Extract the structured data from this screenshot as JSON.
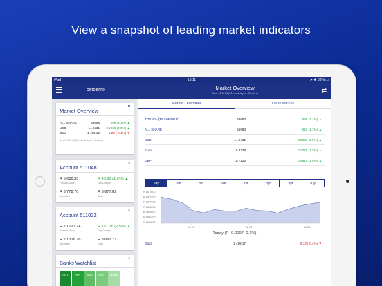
{
  "headline": "View a snapshot of leading market indicators",
  "status_bar": {
    "device": "iPad",
    "time": "16:11",
    "battery": "83%"
  },
  "app_header": {
    "user": "ostdemo",
    "title": "Market Overview",
    "subtitle": "As at 16:11:53 (15 min delayed - Reuters)"
  },
  "sidebar": {
    "market_overview": {
      "title": "Market Overview",
      "rows": [
        {
          "name": "ALL SHARE",
          "value": "55668",
          "change": "596 (1.1%)",
          "dir": "up"
        },
        {
          "name": "USD",
          "value": "14.9431",
          "change": "0.2926 (2.0%)",
          "dir": "up"
        },
        {
          "name": "Gold",
          "value": "1 499.10",
          "change": "-6.20 (-0.4%)",
          "dir": "down"
        }
      ],
      "note": "As at 16:04:42 (15 min delayed - Reuters)"
    },
    "accounts": [
      {
        "title": "Account 511048",
        "portfolio_value": "R 5 056.33",
        "portfolio_label": "Portfolio Value",
        "day_change": "R 48.80 (1.3%)",
        "day_change_label": "Day Change",
        "securities": "R 3 772.70",
        "securities_label": "Securities",
        "cash": "R 3 677.82",
        "cash_label": "Cash"
      },
      {
        "title": "Account 511022",
        "portfolio_value": "R 20 127.24",
        "portfolio_label": "Portfolio Value",
        "day_change": "R 181.76 (2.5%)",
        "day_change_label": "Day Change",
        "securities": "R 20 316.76",
        "securities_label": "Securities",
        "cash": "R 3 682.71",
        "cash_label": "Cash"
      }
    ],
    "watchlist": {
      "title": "Banks Watchlist",
      "cells": [
        {
          "label": "ACT",
          "color": "#1a8a2e"
        },
        {
          "label": "INP",
          "color": "#22a33a"
        },
        {
          "label": "SBK",
          "color": "#5fbd63"
        },
        {
          "label": "FSR",
          "color": "#7ccb7e"
        },
        {
          "label": "Nedb",
          "color": "#a6dca6"
        }
      ]
    }
  },
  "main": {
    "tabs": [
      {
        "label": "Market Overview"
      },
      {
        "label": "Local Indices"
      }
    ],
    "indices": [
      {
        "name": "TOP 40 - (TRADEABLE)",
        "value": "49663",
        "change": "530 (1.1%)",
        "dir": "up"
      },
      {
        "name": "ALL SHARE",
        "value": "55683",
        "change": "611 (1.1%)",
        "dir": "up"
      },
      {
        "name": "USD",
        "value": "14.9431",
        "change": "0.2926 (2.0%)",
        "dir": "up"
      },
      {
        "name": "Euro",
        "value": "16.4778",
        "change": "0.2778 (1.7%)",
        "dir": "up"
      },
      {
        "name": "GBP",
        "value": "18.7122",
        "change": "0.4618 (2.5%)",
        "dir": "up"
      }
    ],
    "ranges": [
      "1dy",
      "1m",
      "3m",
      "6m",
      "1yr",
      "3yr",
      "5yr",
      "10yr"
    ],
    "active_range": "1dy",
    "today_summary": "Today (R -0.0097 -0.1%)",
    "gold_row": {
      "name": "Gold",
      "value": "1 499.17",
      "change": "-6.13 (-0.4%)",
      "dir": "down"
    }
  },
  "chart_data": {
    "type": "area",
    "x": [
      "09:00",
      "09:30",
      "10:00",
      "10:30",
      "11:00",
      "11:30",
      "12:00",
      "12:30",
      "13:00",
      "13:30",
      "14:00",
      "14:30",
      "15:00",
      "15:30",
      "16:00",
      "16:10"
    ],
    "series": [
      {
        "values": [
          18.735,
          18.725,
          18.71,
          18.675,
          18.665,
          18.68,
          18.674,
          18.672,
          18.686,
          18.676,
          18.674,
          18.664,
          18.682,
          18.695,
          18.705,
          18.712
        ]
      }
    ],
    "y_ticks": [
      "R 18.7600",
      "R 18.7200",
      "R 18.7000",
      "R 18.6800",
      "R 18.6600",
      "R 18.6400",
      "R 18.6200"
    ],
    "x_ticks": [
      "09:46",
      "12:37",
      "15:26"
    ],
    "ylim": [
      18.62,
      18.76
    ],
    "fill_color": "#c9d1ec",
    "line_color": "#7383bf"
  }
}
